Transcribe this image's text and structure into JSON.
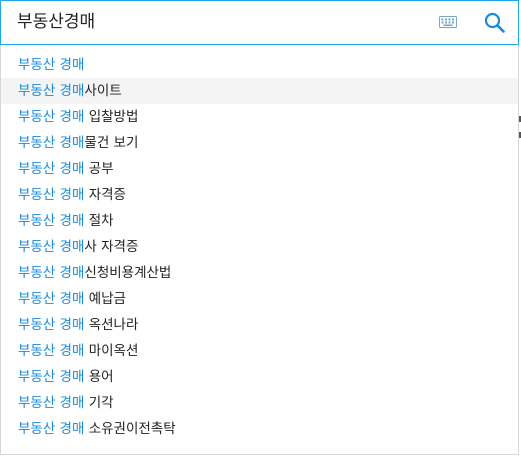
{
  "search": {
    "value": "부동산경매",
    "keyboard_icon": "keyboard-icon",
    "search_icon": "magnifier-icon"
  },
  "colors": {
    "accent": "#1ea7e8",
    "highlight_text": "#1a8bd8",
    "hover_row": "#f4f4f4"
  },
  "suggestions": [
    {
      "match": "부동산 경매",
      "rest": ""
    },
    {
      "match": "부동산 경매",
      "rest": "사이트"
    },
    {
      "match": "부동산 경매",
      "rest": " 입찰방법"
    },
    {
      "match": "부동산 경매",
      "rest": "물건 보기"
    },
    {
      "match": "부동산 경매",
      "rest": " 공부"
    },
    {
      "match": "부동산 경매",
      "rest": " 자격증"
    },
    {
      "match": "부동산 경매",
      "rest": " 절차"
    },
    {
      "match": "부동산 경매",
      "rest": "사 자격증"
    },
    {
      "match": "부동산 경매",
      "rest": "신청비용계산법"
    },
    {
      "match": "부동산 경매",
      "rest": " 예납금"
    },
    {
      "match": "부동산 경매",
      "rest": " 옥션나라"
    },
    {
      "match": "부동산 경매",
      "rest": " 마이옥션"
    },
    {
      "match": "부동산 경매",
      "rest": " 용어"
    },
    {
      "match": "부동산 경매",
      "rest": " 기각"
    },
    {
      "match": "부동산 경매",
      "rest": " 소유권이전촉탁"
    }
  ]
}
